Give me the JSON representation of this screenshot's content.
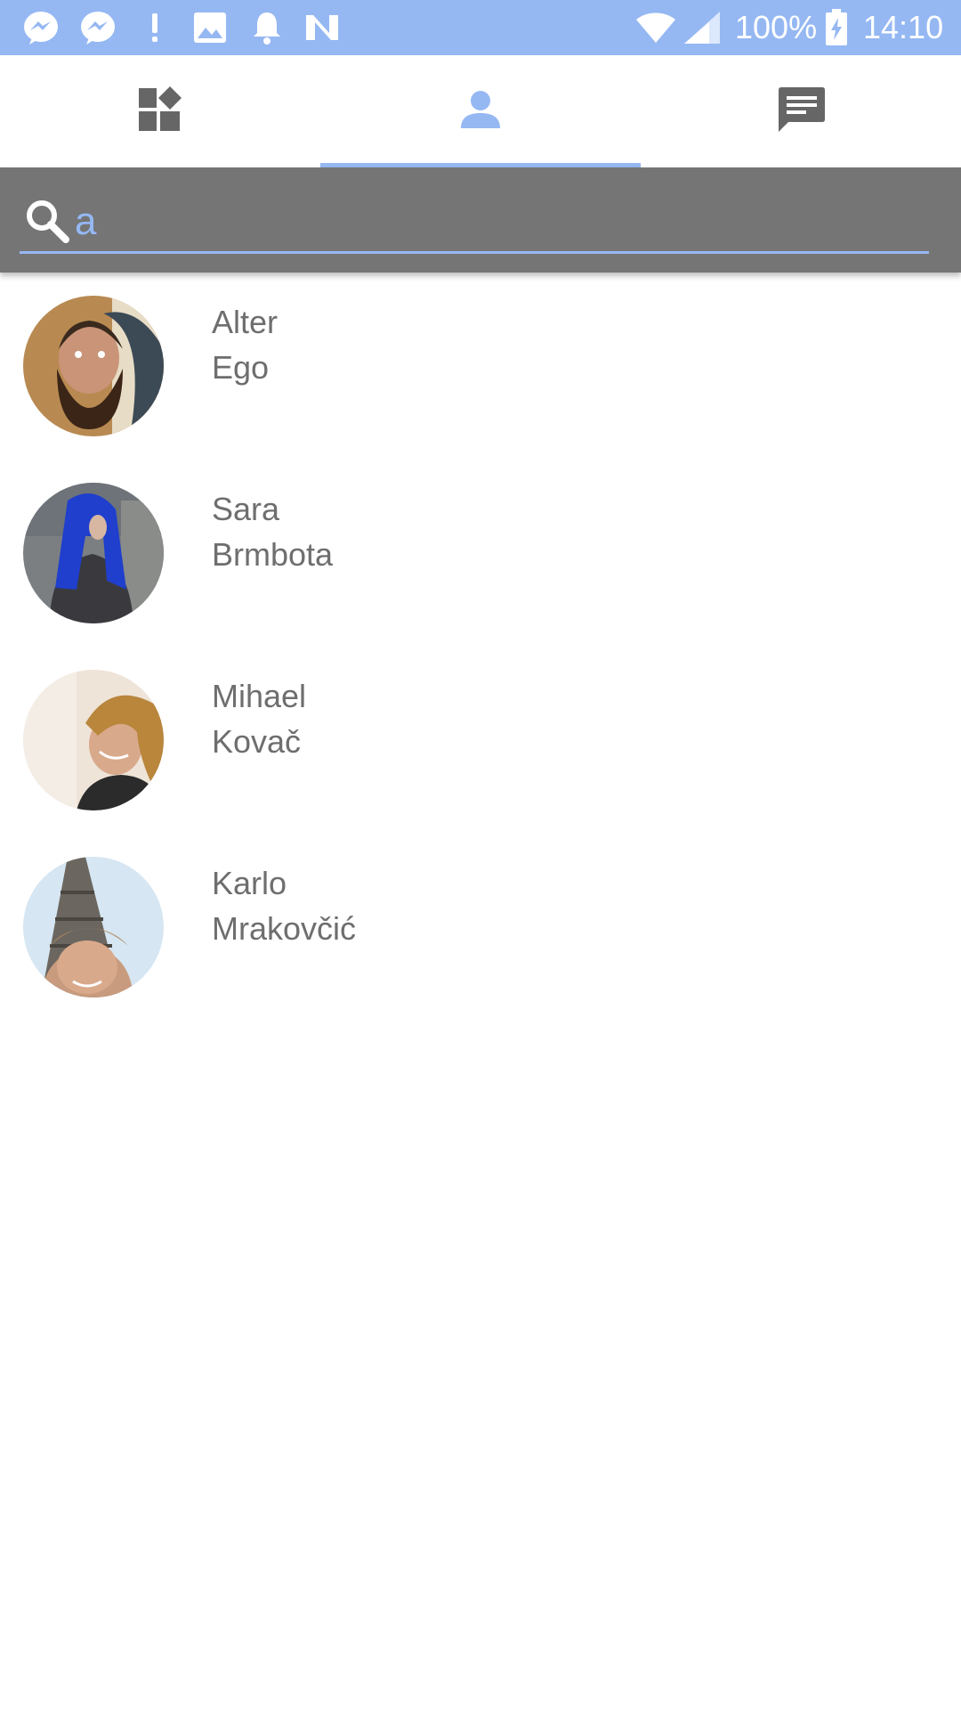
{
  "status_bar": {
    "battery": "100%",
    "time": "14:10",
    "notification_icons": [
      "messenger-icon",
      "messenger-icon",
      "alert-icon",
      "image-icon",
      "bell-icon",
      "n-icon"
    ],
    "system_icons": [
      "wifi-icon",
      "signal-icon",
      "battery-charging-icon"
    ]
  },
  "tabs": [
    {
      "icon": "dashboard-icon",
      "selected": false
    },
    {
      "icon": "person-icon",
      "selected": true
    },
    {
      "icon": "chat-icon",
      "selected": false
    }
  ],
  "search": {
    "value": "a"
  },
  "contacts": [
    {
      "first_name": "Alter",
      "last_name": "Ego"
    },
    {
      "first_name": "Sara",
      "last_name": "Brmbota"
    },
    {
      "first_name": "Mihael",
      "last_name": "Kovač"
    },
    {
      "first_name": "Karlo",
      "last_name": "Mrakovčić"
    }
  ],
  "colors": {
    "accent": "#95b8f3",
    "search_bar_bg": "#757575",
    "icon_gray": "#666666",
    "text_gray": "#6e6e6e"
  }
}
